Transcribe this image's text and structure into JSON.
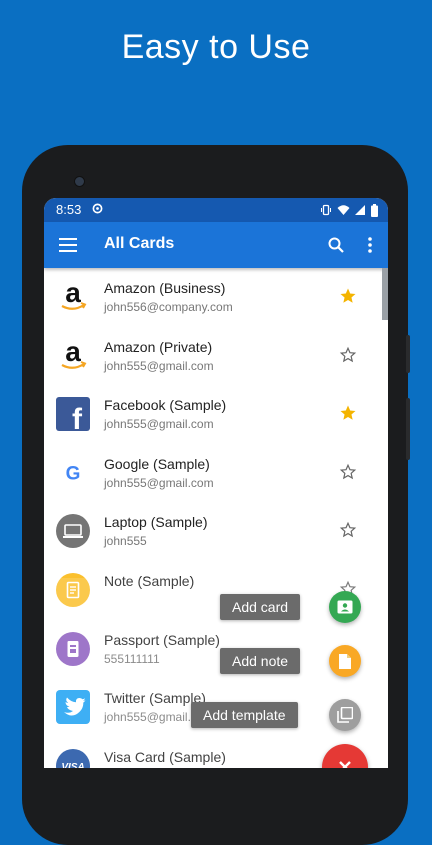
{
  "headline": "Easy to Use",
  "status_bar": {
    "time": "8:53"
  },
  "app_bar": {
    "title": "All Cards"
  },
  "cards": [
    {
      "title": "Amazon (Business)",
      "subtitle": "john556@company.com",
      "icon": "amazon-logo",
      "favorite": true
    },
    {
      "title": "Amazon (Private)",
      "subtitle": "john555@gmail.com",
      "icon": "amazon-logo",
      "favorite": false
    },
    {
      "title": "Facebook (Sample)",
      "subtitle": "john555@gmail.com",
      "icon": "facebook-logo",
      "favorite": true
    },
    {
      "title": "Google (Sample)",
      "subtitle": "john555@gmail.com",
      "icon": "google-logo",
      "favorite": false
    },
    {
      "title": "Laptop (Sample)",
      "subtitle": "john555",
      "icon": "laptop-icon",
      "favorite": false
    },
    {
      "title": "Note (Sample)",
      "subtitle": "",
      "icon": "note-icon",
      "favorite": false
    },
    {
      "title": "Passport (Sample)",
      "subtitle": "555111111",
      "icon": "passport-icon",
      "favorite": false
    },
    {
      "title": "Twitter (Sample)",
      "subtitle": "john555@gmail.com",
      "icon": "twitter-logo",
      "favorite": false
    },
    {
      "title": "Visa Card (Sample)",
      "subtitle": "",
      "icon": "visa-logo",
      "favorite": false
    }
  ],
  "fab_menu": {
    "add_card": "Add card",
    "add_note": "Add note",
    "add_template": "Add template"
  },
  "colors": {
    "background": "#0a6fc2",
    "app_bar": "#1b74d8",
    "status_bar": "#1559b0",
    "star_filled": "#f4b400",
    "fab_card": "#34a853",
    "fab_note": "#f9a825",
    "fab_template": "#9e9e9e",
    "fab_main": "#e53935"
  }
}
